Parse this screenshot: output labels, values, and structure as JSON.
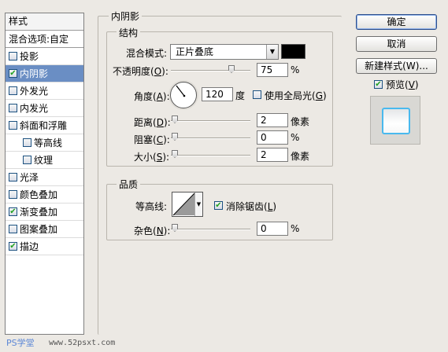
{
  "sidebar": {
    "header": "样式",
    "blend_options": "混合选项:自定",
    "items": [
      {
        "label": "投影",
        "checked": false,
        "selected": false,
        "sub": false
      },
      {
        "label": "内阴影",
        "checked": true,
        "selected": true,
        "sub": false
      },
      {
        "label": "外发光",
        "checked": false,
        "selected": false,
        "sub": false
      },
      {
        "label": "内发光",
        "checked": false,
        "selected": false,
        "sub": false
      },
      {
        "label": "斜面和浮雕",
        "checked": false,
        "selected": false,
        "sub": false
      },
      {
        "label": "等高线",
        "checked": false,
        "selected": false,
        "sub": true
      },
      {
        "label": "纹理",
        "checked": false,
        "selected": false,
        "sub": true
      },
      {
        "label": "光泽",
        "checked": false,
        "selected": false,
        "sub": false
      },
      {
        "label": "颜色叠加",
        "checked": false,
        "selected": false,
        "sub": false
      },
      {
        "label": "渐变叠加",
        "checked": true,
        "selected": false,
        "sub": false
      },
      {
        "label": "图案叠加",
        "checked": false,
        "selected": false,
        "sub": false
      },
      {
        "label": "描边",
        "checked": true,
        "selected": false,
        "sub": false
      }
    ]
  },
  "inner_shadow": {
    "title": "内阴影",
    "structure": {
      "title": "结构",
      "blend_mode_label": "混合模式:",
      "blend_mode_value": "正片叠底",
      "shadow_color": "#000000",
      "opacity_label": "不透明度(",
      "opacity_key": "O",
      "opacity_value": "75",
      "opacity_unit": "%",
      "angle_label": "角度(",
      "angle_key": "A",
      "angle_value": "120",
      "angle_unit": "度",
      "global_light_label": "使用全局光(",
      "global_light_key": "G",
      "global_light_checked": false,
      "distance_label": "距离(",
      "distance_key": "D",
      "distance_value": "2",
      "distance_unit": "像素",
      "choke_label": "阻塞(",
      "choke_key": "C",
      "choke_value": "0",
      "choke_unit": "%",
      "size_label": "大小(",
      "size_key": "S",
      "size_value": "2",
      "size_unit": "像素"
    },
    "quality": {
      "title": "品质",
      "contour_label": "等高线:",
      "antialias_label": "消除锯齿(",
      "antialias_key": "L",
      "antialias_checked": true,
      "noise_label": "杂色(",
      "noise_key": "N",
      "noise_value": "0",
      "noise_unit": "%"
    }
  },
  "buttons": {
    "ok": "确定",
    "cancel": "取消",
    "new_style": "新建样式(W)...",
    "preview_label": "预览(",
    "preview_key": "V",
    "preview_checked": true
  },
  "watermark": {
    "logo": "PS学堂",
    "url": "www.52psxt.com"
  },
  "colors": {
    "selection": "#6a8ec4",
    "preview_border": "#49b9ee"
  }
}
